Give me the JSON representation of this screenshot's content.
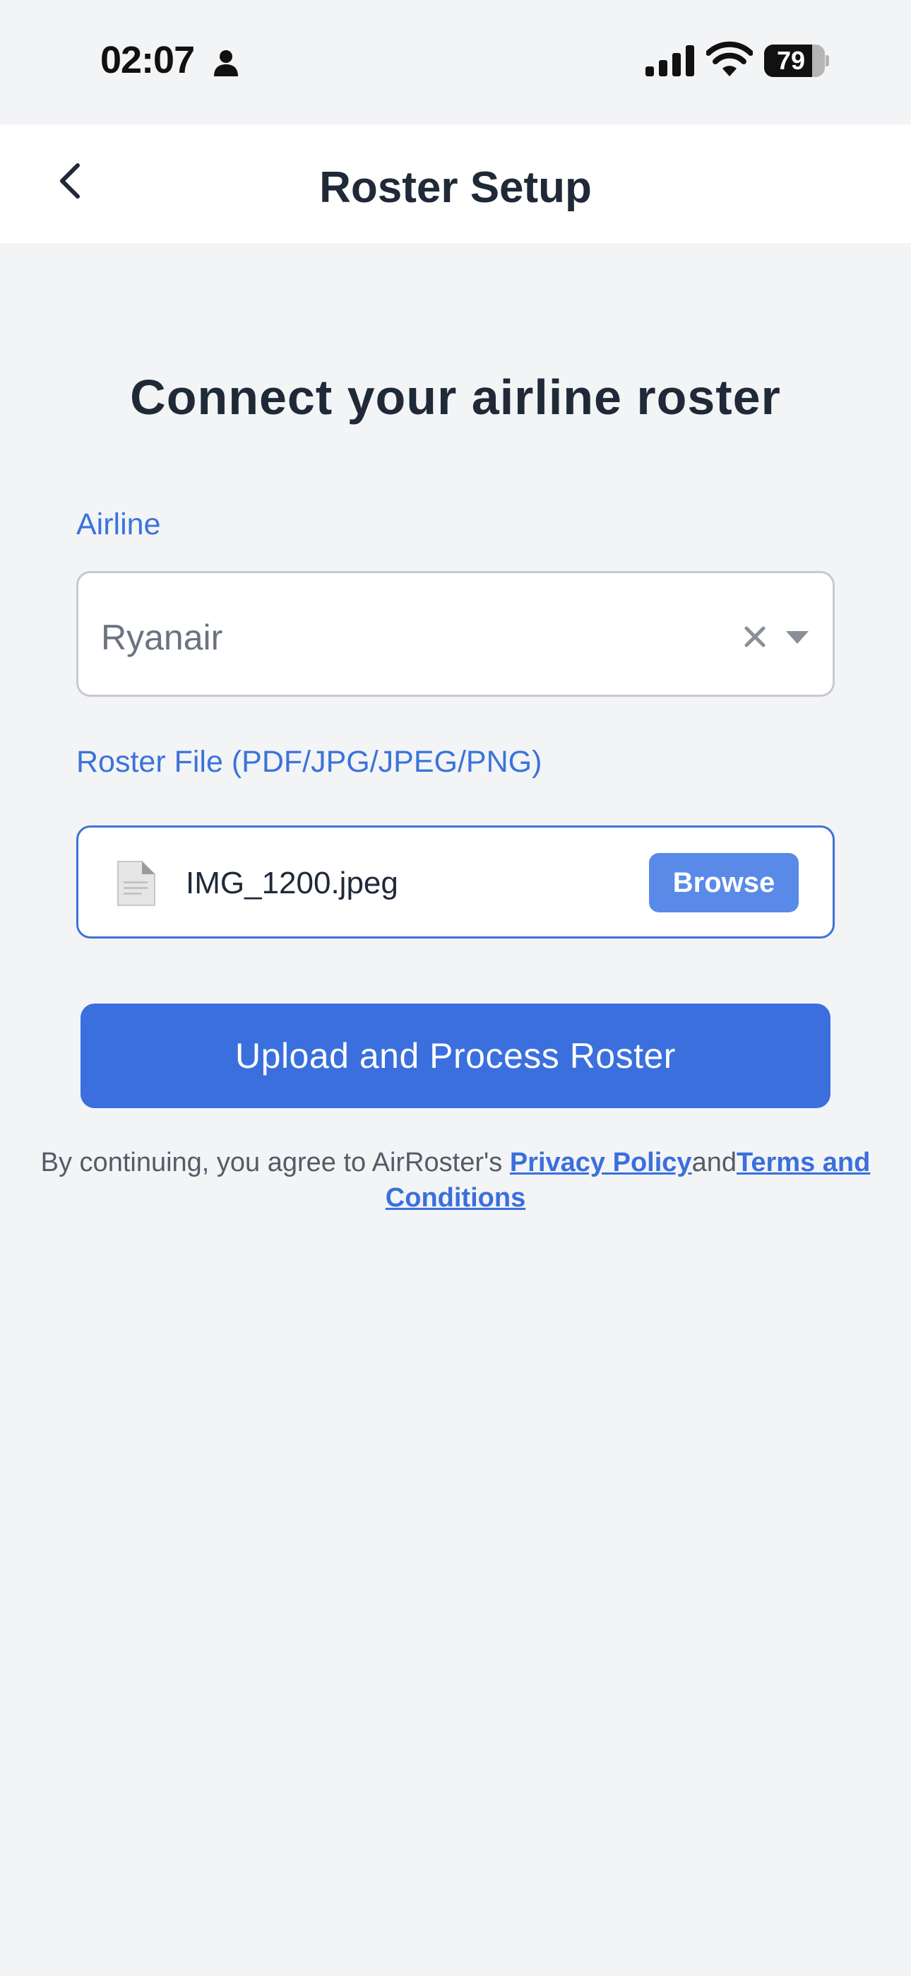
{
  "status_bar": {
    "time": "02:07",
    "battery_percent": 79,
    "battery_label": "79",
    "icons": [
      "person-icon",
      "signal-icon",
      "wifi-icon",
      "battery-icon"
    ]
  },
  "header": {
    "title": "Roster Setup",
    "back_icon": "chevron-left-icon"
  },
  "main": {
    "title": "Connect your airline roster",
    "airline": {
      "label": "Airline",
      "value": "Ryanair",
      "clear_icon": "close-icon",
      "dropdown_icon": "caret-down-icon"
    },
    "roster_file": {
      "label": "Roster File (PDF/JPG/JPEG/PNG)",
      "file_name": "IMG_1200.jpeg",
      "file_icon": "document-icon",
      "browse_label": "Browse"
    },
    "upload_label": "Upload and Process Roster",
    "legal": {
      "prefix": "By continuing, you agree to AirRoster's ",
      "privacy_link": "Privacy Policy",
      "connector": "and",
      "terms_link": "Terms and Conditions"
    }
  },
  "colors": {
    "accent": "#3a6fdd",
    "browse": "#5a8ae8",
    "background": "#f3f4f6",
    "label": "#3b73d9"
  }
}
